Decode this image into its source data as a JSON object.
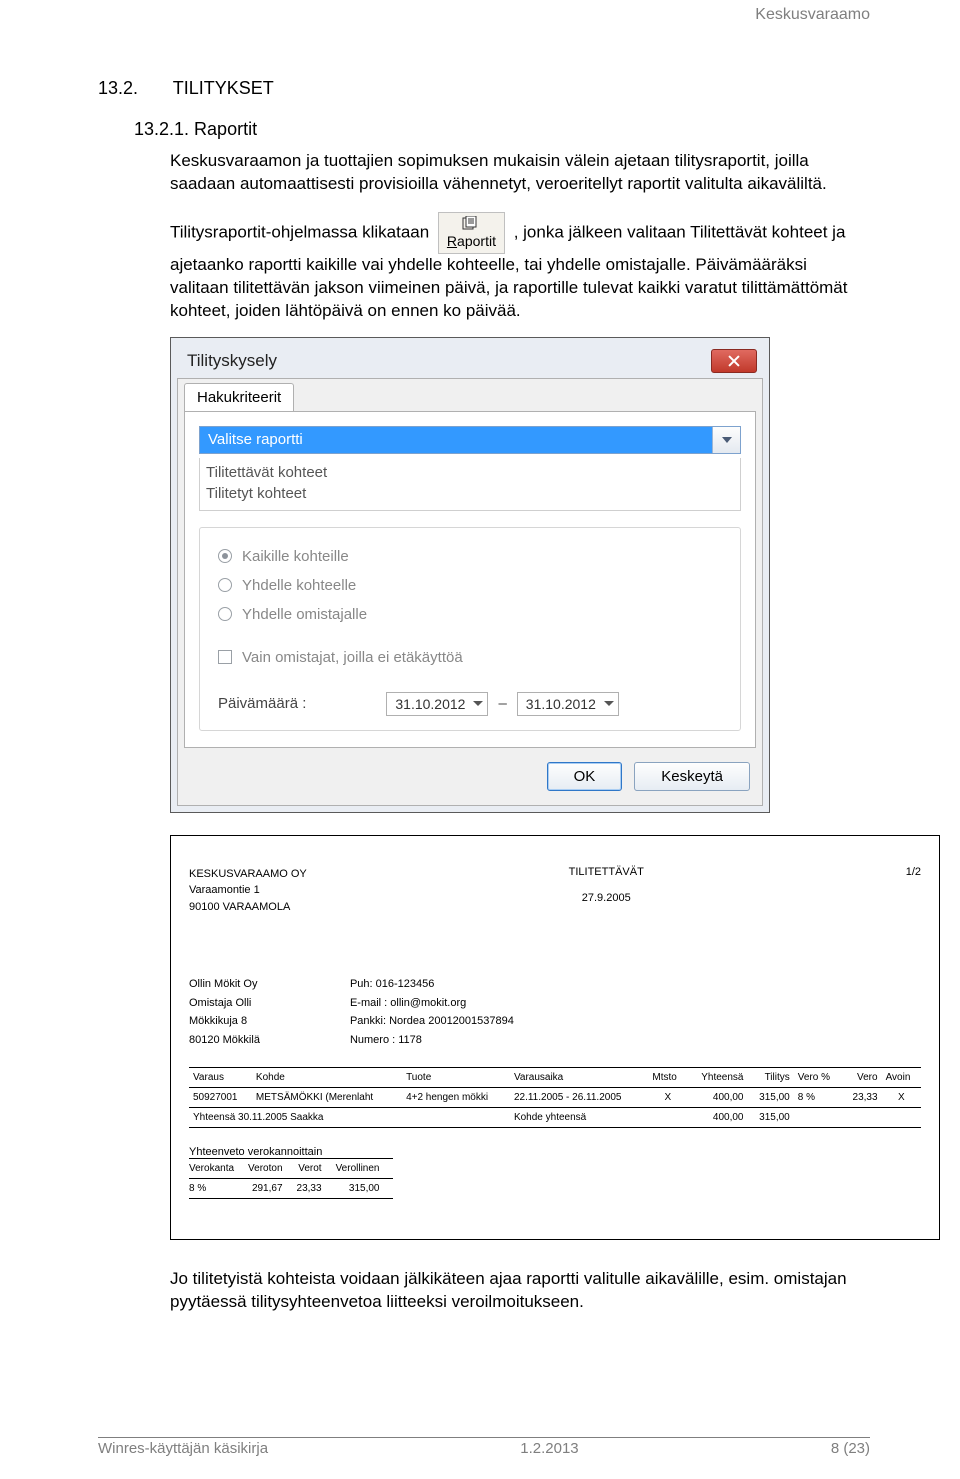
{
  "header": {
    "running": "Keskusvaraamo"
  },
  "section": {
    "num_title": "13.2.",
    "title": "TILITYKSET"
  },
  "subsection": {
    "num_title": "13.2.1. Raportit"
  },
  "para1": "Keskusvaraamon ja tuottajien sopimuksen mukaisin välein ajetaan tilitysraportit, joilla saadaan automaattisesti provisioilla vähennetyt, veroeritellyt raportit valitulta aikaväliltä.",
  "para2_before": "Tilitysraportit-ohjelmassa klikataan ",
  "raportit_btn_html": "<u>R</u>aportit",
  "raportit_btn_text": "Raportit",
  "para2_after": ", jonka jälkeen valitaan Tilitettävät kohteet ja ajetaanko raportti kaikille vai yhdelle kohteelle, tai yhdelle omistajalle. Päivämääräksi valitaan tilitettävän jakson viimeinen päivä, ja raportille tulevat kaikki varatut tilittämättömät kohteet, joiden lähtöpäivä on ennen ko päivää.",
  "dialog": {
    "title": "Tilityskysely",
    "tab": "Hakukriteerit",
    "combo_selected": "Valitse raportti",
    "list": [
      "Tilitettävät kohteet",
      "Tilitetyt kohteet"
    ],
    "radios": [
      {
        "label": "Kaikille kohteille",
        "checked": true
      },
      {
        "label": "Yhdelle kohteelle",
        "checked": false
      },
      {
        "label": "Yhdelle omistajalle",
        "checked": false
      }
    ],
    "checkbox_label": "Vain omistajat, joilla ei etäkäyttöä",
    "date_label": "Päivämäärä :",
    "date_from": "31.10.2012",
    "date_sep": "–",
    "date_to": "31.10.2012",
    "ok": "OK",
    "cancel": "Keskeytä"
  },
  "report": {
    "company": "KESKUSVARAAMO OY",
    "addr1": "Varaamontie 1",
    "addr2": "90100 VARAAMOLA",
    "title": "TILITETTÄVÄT",
    "date": "27.9.2005",
    "page": "1/2",
    "owner": {
      "name": "Ollin Mökit Oy",
      "contact": "Omistaja Olli",
      "street": "Mökkikuja 8",
      "city": "80120 Mökkilä",
      "phone_label": "Puh:",
      "phone": "016-123456",
      "email_label": "E-mail :",
      "email": "ollin@mokit.org",
      "bank_label": "Pankki:",
      "bank": "Nordea 20012001537894",
      "num_label": "Numero :",
      "num": "1178"
    },
    "th": [
      "Varaus",
      "Kohde",
      "Tuote",
      "Varausaika",
      "Mtsto",
      "Yhteensä",
      "Tilitys",
      "Vero %",
      "Vero",
      "Avoin"
    ],
    "row": {
      "varaus": "50927001",
      "kohde": "METSÄMÖKKI (Merenlaht",
      "tuote": "4+2 hengen mökki",
      "aika": "22.11.2005 - 26.11.2005",
      "mtsto": "X",
      "yht": "400,00",
      "tilitys": "315,00",
      "veropct": "8 %",
      "vero": "23,33",
      "avoin": "X"
    },
    "sum_label": "Yhteensä 30.11.2005 Saakka",
    "sum_mid": "Kohde yhteensä",
    "sum_yht": "400,00",
    "sum_til": "315,00",
    "tax_title": "Yhteenveto verokannoittain",
    "tax_th": [
      "Verokanta",
      "Veroton",
      "Verot",
      "Verollinen"
    ],
    "tax_row": {
      "kanta": "8 %",
      "veroton": "291,67",
      "verot": "23,33",
      "verollinen": "315,00"
    }
  },
  "para3": "Jo tilitetyistä kohteista voidaan jälkikäteen ajaa raportti valitulle aikavälille, esim. omistajan pyytäessä tilitysyhteenvetoa liitteeksi veroilmoitukseen.",
  "footer": {
    "left": "Winres-käyttäjän käsikirja",
    "center": "1.2.2013",
    "right": "8 (23)"
  }
}
